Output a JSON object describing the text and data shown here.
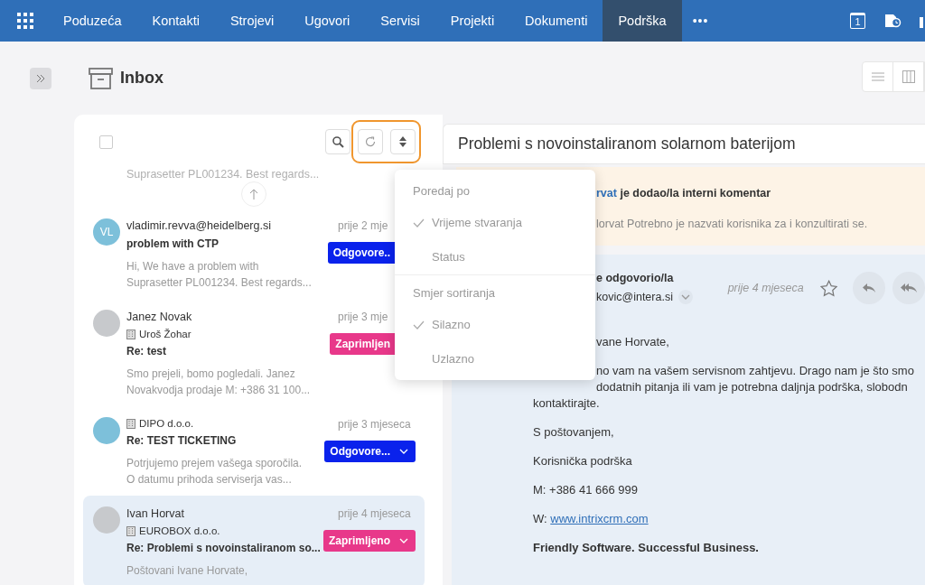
{
  "nav": {
    "items": [
      {
        "label": "Poduzeća",
        "selected": false
      },
      {
        "label": "Kontakti",
        "selected": false
      },
      {
        "label": "Strojevi",
        "selected": false
      },
      {
        "label": "Ugovori",
        "selected": false
      },
      {
        "label": "Servisi",
        "selected": false
      },
      {
        "label": "Projekti",
        "selected": false
      },
      {
        "label": "Dokumenti",
        "selected": false
      },
      {
        "label": "Podrška",
        "selected": true
      }
    ],
    "more": "•••",
    "calendar_day": "1"
  },
  "page_title": "Inbox",
  "list": {
    "select_all": {
      "checked": false
    },
    "faded_preview": "Suprasetter PL001234. Best regards...",
    "items": [
      {
        "avatar": {
          "kind": "initials",
          "text": "VL"
        },
        "sender": "vladimir.revva@heidelberg.si",
        "subject": "problem with CTP",
        "time": "prije 2 mje",
        "status": {
          "label": "Odgovore..",
          "kind": "answered"
        },
        "preview": [
          "Hi, We have a problem with",
          "Suprasetter PL001234. Best regards..."
        ],
        "selected": false
      },
      {
        "avatar": {
          "kind": "photo"
        },
        "sender": "Janez Novak",
        "company": "Uroš Žohar",
        "subject": "Re: test",
        "time": "prije 3 mje",
        "status": {
          "label": "Zaprimljen",
          "kind": "received"
        },
        "preview": [
          "Smo prejeli, bomo pogledali. Janez",
          "Novakvodja prodaje M: +386 31 100..."
        ],
        "selected": false
      },
      {
        "avatar": {
          "kind": "blank"
        },
        "company": "DIPO d.o.o.",
        "subject": "Re: TEST TICKETING",
        "time": "prije 3 mjeseca",
        "status": {
          "label": "Odgovore...",
          "kind": "answered"
        },
        "preview": [
          "Potrjujemo prejem vašega sporočila.",
          "O datumu prihoda serviserja vas..."
        ],
        "selected": false
      },
      {
        "avatar": {
          "kind": "photo"
        },
        "sender": "Ivan Horvat",
        "company": "EUROBOX d.o.o.",
        "subject": "Re: Problemi s novoinstaliranom so...",
        "time": "prije 4 mjeseca",
        "status": {
          "label": "Zaprimljeno",
          "kind": "received"
        },
        "preview": [
          "Poštovani Ivane Horvate,"
        ],
        "selected": true
      }
    ]
  },
  "sort_menu": {
    "sections": [
      {
        "heading": "Poredaj po",
        "options": [
          {
            "label": "Vrijeme stvaranja",
            "selected": true
          },
          {
            "label": "Status",
            "selected": false
          }
        ]
      },
      {
        "heading": "Smjer sortiranja",
        "options": [
          {
            "label": "Silazno",
            "selected": true
          },
          {
            "label": "Uzlazno",
            "selected": false
          }
        ]
      }
    ]
  },
  "detail": {
    "title": "Problemi s novoinstaliranom solarnom baterijom",
    "comment": {
      "author": "rvat",
      "action": "je dodao/la interni komentar",
      "text": "lorvat  Potrebno je nazvati korisnika za i konzultirati se."
    },
    "email": {
      "action": "e odgovorio/la",
      "address": "kovic@intera.si",
      "time": "prije 4 mjeseca",
      "greeting": "vane Horvate,",
      "paragraph": {
        "partly_hidden_lines": [
          "no vam na vašem servisnom zahtjevu. Drago nam je što smo",
          "dodatnih pitanja ili vam je potrebna daljnja podrška, slobodn"
        ],
        "lines": [
          "kontaktirajte."
        ]
      },
      "signature": [
        {
          "kind": "text",
          "text": "S poštovanjem,"
        },
        {
          "kind": "text",
          "text": "Korisnička podrška"
        },
        {
          "kind": "text",
          "text": "M: +386 41 666 999"
        },
        {
          "kind": "link",
          "prefix": "W:",
          "link": "www.intrixcrm.com"
        },
        {
          "kind": "bold",
          "text": "Friendly Software. Successful Business."
        }
      ]
    }
  }
}
